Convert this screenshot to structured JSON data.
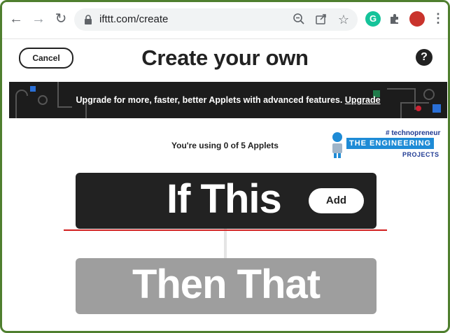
{
  "browser": {
    "url": "ifttt.com/create",
    "icons": [
      "back-arrow-icon",
      "forward-arrow-icon",
      "reload-icon",
      "lock-icon",
      "zoom-out-icon",
      "share-icon",
      "star-icon",
      "grammarly-icon",
      "extensions-puzzle-icon",
      "profile-avatar",
      "more-menu-icon"
    ]
  },
  "header": {
    "cancel_label": "Cancel",
    "title": "Create your own",
    "help_label": "?"
  },
  "banner": {
    "text": "Upgrade for more, faster, better Applets with advanced features.",
    "link_label": "Upgrade"
  },
  "usage": {
    "text": "You're using 0 of 5 Applets"
  },
  "watermark": {
    "tag": "# technopreneur",
    "main": "THE ENGINEERING",
    "sub": "PROJECTS"
  },
  "builder": {
    "if_label": "If This",
    "add_label": "Add",
    "then_label": "Then That"
  },
  "colors": {
    "frame_border": "#4f7f2f",
    "dark": "#222222",
    "disabled_block": "#9e9e9e",
    "annotation_line": "#d21f1f",
    "banner_bg": "#1c1c1c"
  }
}
